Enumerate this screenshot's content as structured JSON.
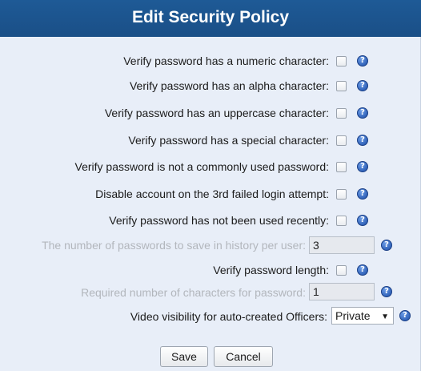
{
  "dialog": {
    "title": "Edit Security Policy"
  },
  "rows": [
    {
      "label": "Verify password has a numeric character:",
      "checked": false
    },
    {
      "label": "Verify password has an alpha character:",
      "checked": false
    },
    {
      "label": "Verify password has an uppercase character:",
      "checked": false
    },
    {
      "label": "Verify password has a special character:",
      "checked": false
    },
    {
      "label": "Verify password is not a commonly used password:",
      "checked": false
    },
    {
      "label": "Disable account on the 3rd failed login attempt:",
      "checked": false
    },
    {
      "label": "Verify password has not been used recently:",
      "checked": false
    }
  ],
  "history_count": {
    "label": "The number of passwords to save in history per user:",
    "value": "3",
    "enabled": false
  },
  "length_check": {
    "label": "Verify password length:",
    "checked": false
  },
  "required_chars": {
    "label": "Required number of characters for password:",
    "value": "1",
    "enabled": false
  },
  "video_visibility": {
    "label": "Video visibility for auto-created Officers:",
    "selected": "Private"
  },
  "help_glyph": "?",
  "buttons": {
    "save": "Save",
    "cancel": "Cancel"
  },
  "colors": {
    "title_bar": "#1e5a96",
    "panel_bg": "#e8eef8",
    "help_icon": "#1c4ea8",
    "disabled_text": "#b2b6bc"
  }
}
